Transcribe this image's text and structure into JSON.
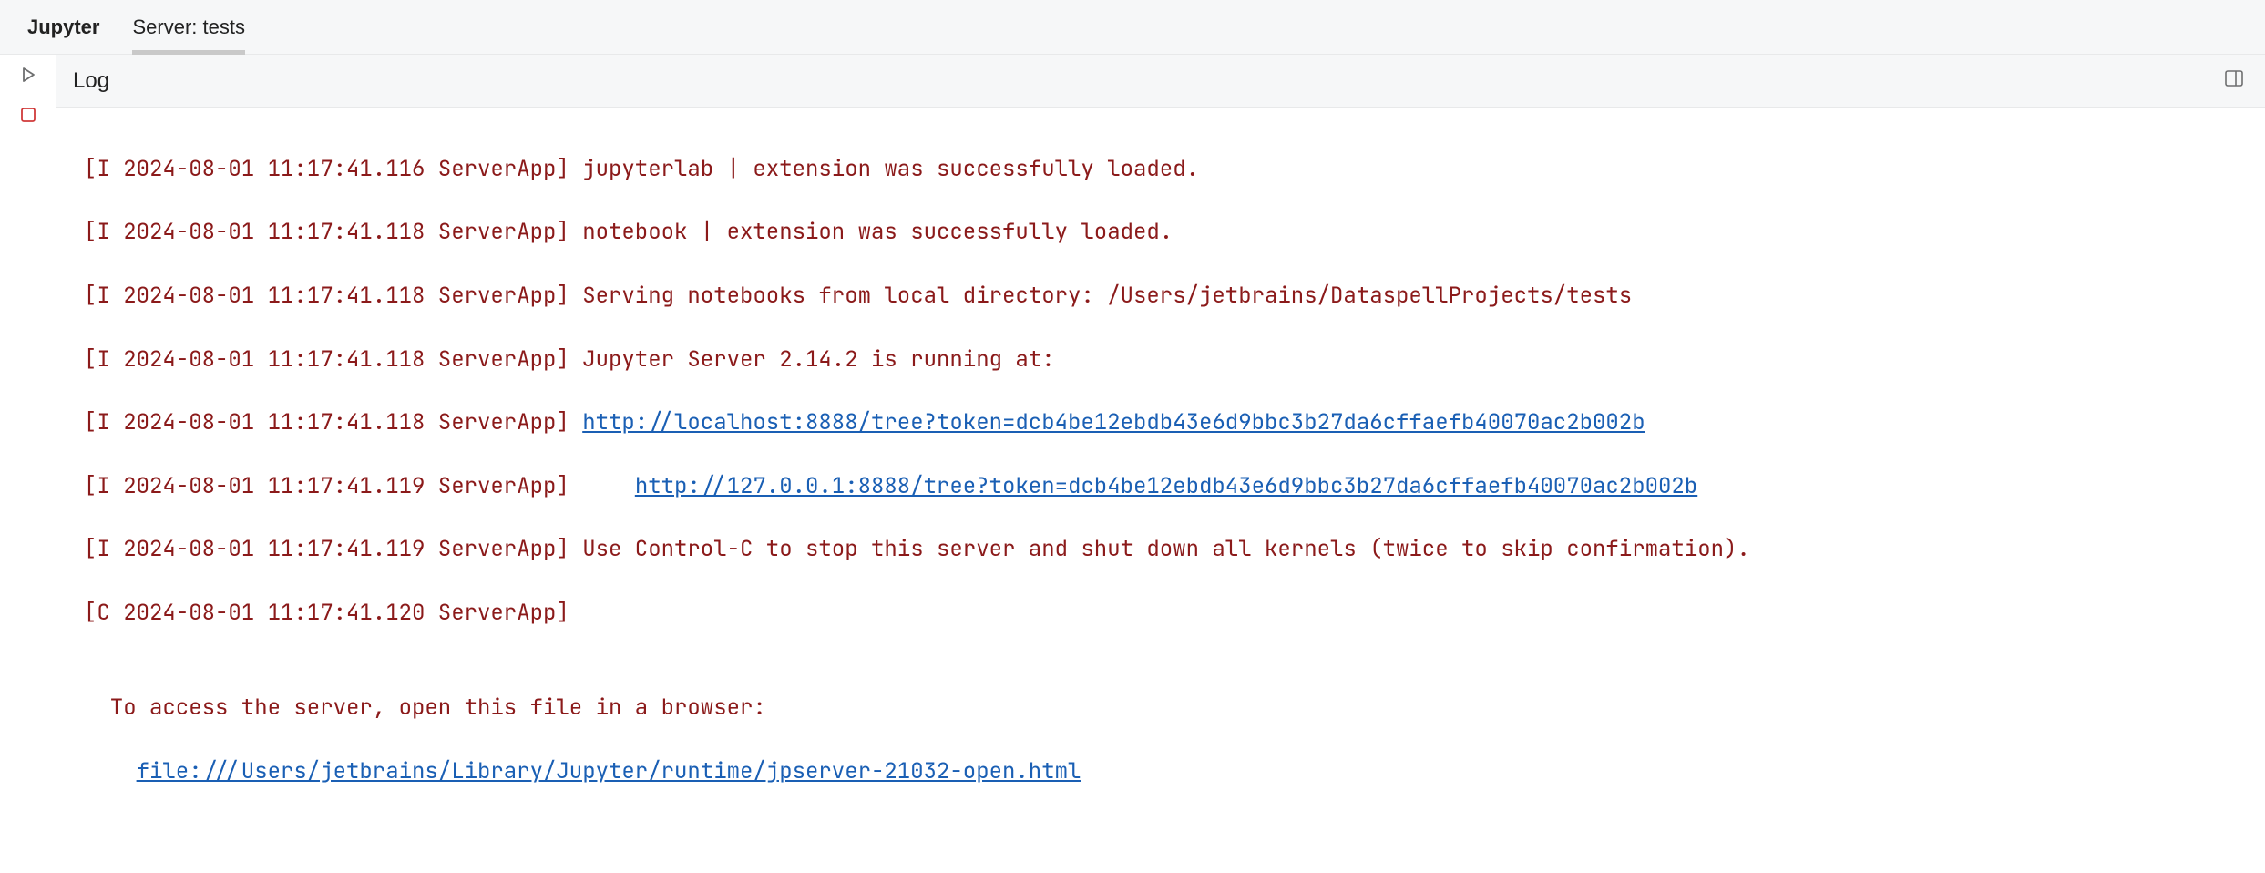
{
  "topbar": {
    "jupyter_label": "Jupyter",
    "server_label": "Server: tests"
  },
  "content_header": {
    "title": "Log"
  },
  "icons": {
    "run": "run-icon",
    "stop": "stop-icon",
    "layout": "layout-panel-icon"
  },
  "log": {
    "lines": [
      {
        "prefix": "[I 2024-08-01 11:17:41.116 ServerApp] ",
        "text": "jupyterlab | extension was successfully loaded."
      },
      {
        "prefix": "[I 2024-08-01 11:17:41.118 ServerApp] ",
        "text": "notebook | extension was successfully loaded."
      },
      {
        "prefix": "[I 2024-08-01 11:17:41.118 ServerApp] ",
        "text": "Serving notebooks from local directory: /Users/jetbrains/DataspellProjects/tests"
      },
      {
        "prefix": "[I 2024-08-01 11:17:41.118 ServerApp] ",
        "text": "Jupyter Server 2.14.2 is running at:"
      },
      {
        "prefix": "[I 2024-08-01 11:17:41.118 ServerApp] ",
        "link": "http://localhost:8888/tree?token=dcb4be12ebdb43e6d9bbc3b27da6cffaefb40070ac2b002b"
      },
      {
        "prefix": "[I 2024-08-01 11:17:41.119 ServerApp]     ",
        "link": "http://127.0.0.1:8888/tree?token=dcb4be12ebdb43e6d9bbc3b27da6cffaefb40070ac2b002b"
      },
      {
        "prefix": "[I 2024-08-01 11:17:41.119 ServerApp] ",
        "text": "Use Control-C to stop this server and shut down all kernels (twice to skip confirmation)."
      },
      {
        "prefix": "[C 2024-08-01 11:17:41.120 ServerApp]",
        "text": ""
      }
    ],
    "footer": {
      "access_text": "To access the server, open this file in a browser:",
      "file_link": "file:///Users/jetbrains/Library/Jupyter/runtime/jpserver-21032-open.html"
    }
  }
}
